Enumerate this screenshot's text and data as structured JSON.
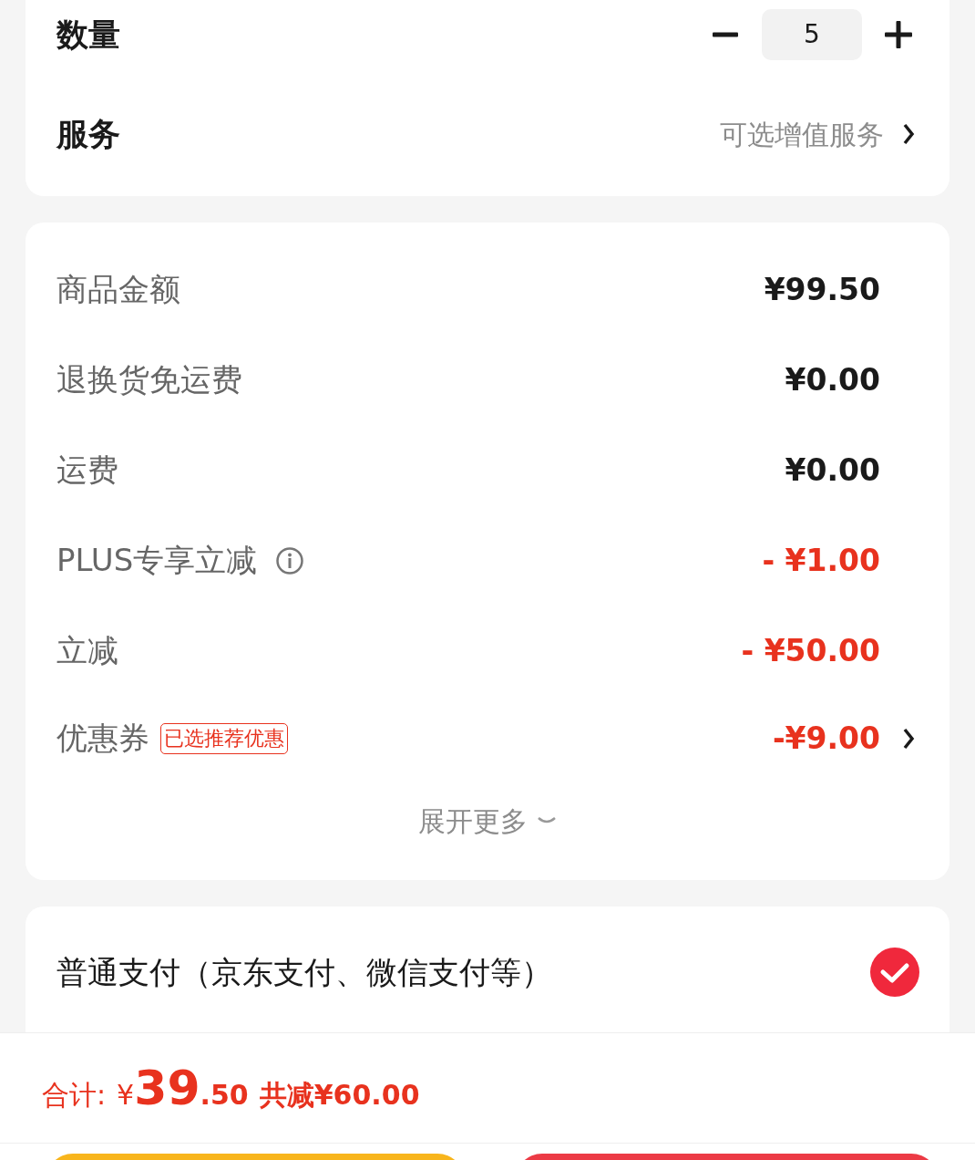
{
  "quantity": {
    "label": "数量",
    "value": "5"
  },
  "service": {
    "label": "服务",
    "value": "可选增值服务"
  },
  "price_rows": [
    {
      "label": "商品金额",
      "amount": "¥99.50",
      "kind": "normal",
      "info": false,
      "arrow": false
    },
    {
      "label": "退换货免运费",
      "amount": "¥0.00",
      "kind": "normal",
      "info": false,
      "arrow": false
    },
    {
      "label": "运费",
      "amount": "¥0.00",
      "kind": "normal",
      "info": false,
      "arrow": false
    },
    {
      "label": "PLUS专享立减",
      "amount": "- ¥1.00",
      "kind": "discount",
      "info": true,
      "arrow": false
    },
    {
      "label": "立减",
      "amount": "- ¥50.00",
      "kind": "discount",
      "info": false,
      "arrow": false
    },
    {
      "label": "优惠券",
      "tag": "已选推荐优惠",
      "amount": "-¥9.00",
      "kind": "discount",
      "info": false,
      "arrow": true
    }
  ],
  "expand": "展开更多",
  "payment": {
    "label": "普通支付（京东支付、微信支付等）",
    "selected": true
  },
  "total": {
    "label": "合计:",
    "currency": "¥",
    "integer": "39",
    "decimals": ".50",
    "saved": "共减¥60.00"
  }
}
